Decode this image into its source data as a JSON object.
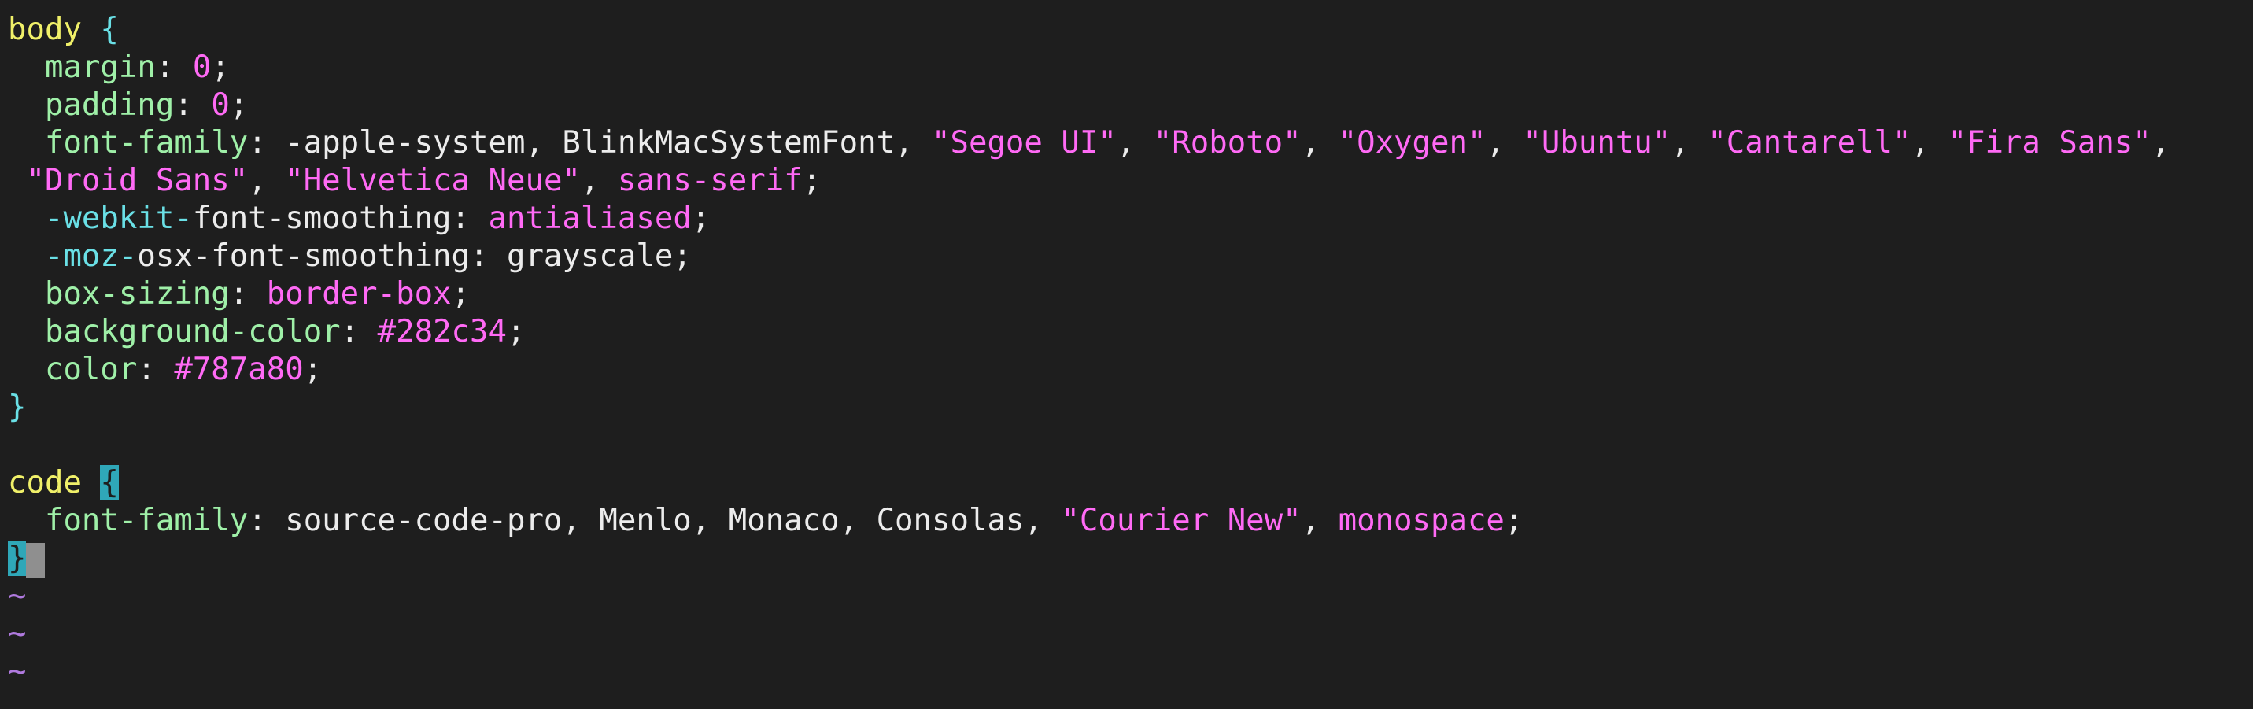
{
  "editor": {
    "mode": "vim",
    "lines": [
      {
        "parts": [
          {
            "cls": "sel",
            "text": "body"
          },
          {
            "cls": "punc",
            "text": " "
          },
          {
            "cls": "brace",
            "text": "{"
          }
        ]
      },
      {
        "parts": [
          {
            "cls": "punc",
            "text": "  "
          },
          {
            "cls": "prop",
            "text": "margin"
          },
          {
            "cls": "punc",
            "text": ": "
          },
          {
            "cls": "kw",
            "text": "0"
          },
          {
            "cls": "punc",
            "text": ";"
          }
        ]
      },
      {
        "parts": [
          {
            "cls": "punc",
            "text": "  "
          },
          {
            "cls": "prop",
            "text": "padding"
          },
          {
            "cls": "punc",
            "text": ": "
          },
          {
            "cls": "kw",
            "text": "0"
          },
          {
            "cls": "punc",
            "text": ";"
          }
        ]
      },
      {
        "parts": [
          {
            "cls": "punc",
            "text": "  "
          },
          {
            "cls": "prop",
            "text": "font-family"
          },
          {
            "cls": "punc",
            "text": ": -apple-system, BlinkMacSystemFont, "
          },
          {
            "cls": "str",
            "text": "\"Segoe UI\""
          },
          {
            "cls": "punc",
            "text": ", "
          },
          {
            "cls": "str",
            "text": "\"Roboto\""
          },
          {
            "cls": "punc",
            "text": ", "
          },
          {
            "cls": "str",
            "text": "\"Oxygen\""
          },
          {
            "cls": "punc",
            "text": ", "
          },
          {
            "cls": "str",
            "text": "\"Ubuntu\""
          },
          {
            "cls": "punc",
            "text": ", "
          },
          {
            "cls": "str",
            "text": "\"Cantarell\""
          },
          {
            "cls": "punc",
            "text": ", "
          },
          {
            "cls": "str",
            "text": "\"Fira Sans\""
          },
          {
            "cls": "punc",
            "text": ","
          }
        ]
      },
      {
        "parts": [
          {
            "cls": "punc",
            "text": " "
          },
          {
            "cls": "str",
            "text": "\"Droid Sans\""
          },
          {
            "cls": "punc",
            "text": ", "
          },
          {
            "cls": "str",
            "text": "\"Helvetica Neue\""
          },
          {
            "cls": "punc",
            "text": ", "
          },
          {
            "cls": "kw",
            "text": "sans-serif"
          },
          {
            "cls": "punc",
            "text": ";"
          }
        ]
      },
      {
        "parts": [
          {
            "cls": "punc",
            "text": "  "
          },
          {
            "cls": "pre",
            "text": "-webkit-"
          },
          {
            "cls": "val",
            "text": "font-smoothing"
          },
          {
            "cls": "punc",
            "text": ": "
          },
          {
            "cls": "kw",
            "text": "antialiased"
          },
          {
            "cls": "punc",
            "text": ";"
          }
        ]
      },
      {
        "parts": [
          {
            "cls": "punc",
            "text": "  "
          },
          {
            "cls": "pre",
            "text": "-moz-"
          },
          {
            "cls": "val",
            "text": "osx-font-smoothing"
          },
          {
            "cls": "punc",
            "text": ": grayscale;"
          }
        ]
      },
      {
        "parts": [
          {
            "cls": "punc",
            "text": "  "
          },
          {
            "cls": "prop",
            "text": "box-sizing"
          },
          {
            "cls": "punc",
            "text": ": "
          },
          {
            "cls": "kw",
            "text": "border-box"
          },
          {
            "cls": "punc",
            "text": ";"
          }
        ]
      },
      {
        "parts": [
          {
            "cls": "punc",
            "text": "  "
          },
          {
            "cls": "prop",
            "text": "background-color"
          },
          {
            "cls": "punc",
            "text": ": "
          },
          {
            "cls": "kw",
            "text": "#282c34"
          },
          {
            "cls": "punc",
            "text": ";"
          }
        ]
      },
      {
        "parts": [
          {
            "cls": "punc",
            "text": "  "
          },
          {
            "cls": "prop",
            "text": "color"
          },
          {
            "cls": "punc",
            "text": ": "
          },
          {
            "cls": "kw",
            "text": "#787a80"
          },
          {
            "cls": "punc",
            "text": ";"
          }
        ]
      },
      {
        "parts": [
          {
            "cls": "brace",
            "text": "}"
          }
        ]
      },
      {
        "parts": []
      },
      {
        "parts": [
          {
            "cls": "sel",
            "text": "code"
          },
          {
            "cls": "punc",
            "text": " "
          },
          {
            "cls": "brace match-brace",
            "text": "{"
          }
        ]
      },
      {
        "parts": [
          {
            "cls": "punc",
            "text": "  "
          },
          {
            "cls": "prop",
            "text": "font-family"
          },
          {
            "cls": "punc",
            "text": ": source-code-pro, Menlo, Monaco, Consolas, "
          },
          {
            "cls": "str",
            "text": "\"Courier New\""
          },
          {
            "cls": "punc",
            "text": ", "
          },
          {
            "cls": "kw",
            "text": "monospace"
          },
          {
            "cls": "punc",
            "text": ";"
          }
        ]
      },
      {
        "parts": [
          {
            "cls": "brace match-brace",
            "text": "}"
          }
        ],
        "cursor": true
      },
      {
        "parts": [
          {
            "cls": "tilde",
            "text": "~"
          }
        ]
      },
      {
        "parts": [
          {
            "cls": "tilde",
            "text": "~"
          }
        ]
      },
      {
        "parts": [
          {
            "cls": "tilde",
            "text": "~"
          }
        ]
      }
    ]
  }
}
